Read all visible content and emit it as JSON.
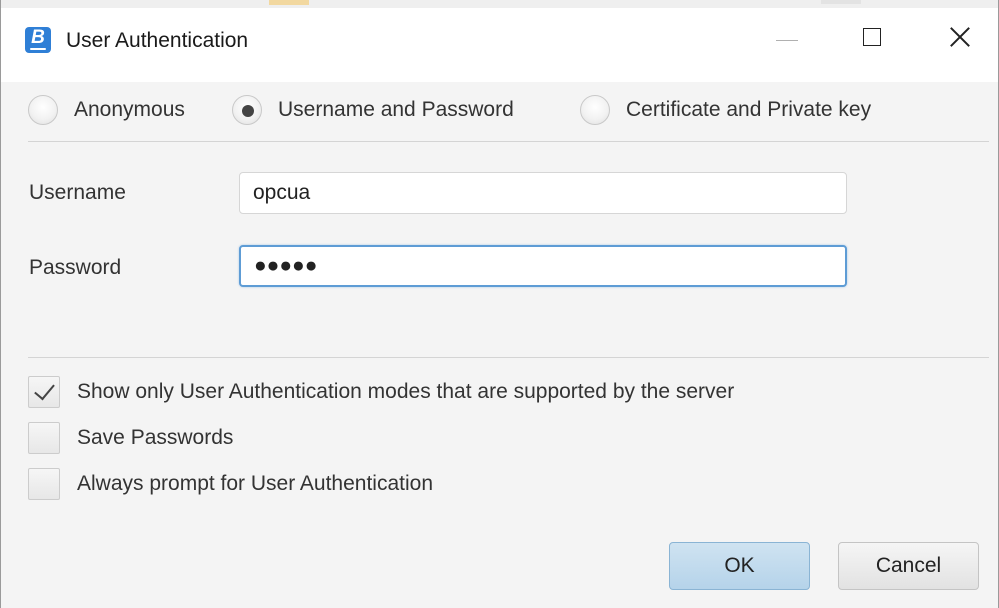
{
  "window": {
    "title": "User Authentication",
    "app_icon_letter": "B",
    "controls": [
      "minimize-icon",
      "maximize-icon",
      "close-icon"
    ]
  },
  "auth_modes": {
    "options": [
      {
        "label": "Anonymous",
        "selected": false
      },
      {
        "label": "Username and Password",
        "selected": true
      },
      {
        "label": "Certificate and Private key",
        "selected": false
      }
    ]
  },
  "form": {
    "username_label": "Username",
    "username_value": "opcua",
    "password_label": "Password",
    "password_value": "●●●●●"
  },
  "options": {
    "show_supported": {
      "label": "Show only User Authentication modes that are supported by the server",
      "checked": true
    },
    "save_passwords": {
      "label": "Save Passwords",
      "checked": false
    },
    "always_prompt": {
      "label": "Always prompt for User Authentication",
      "checked": false
    }
  },
  "buttons": {
    "ok": "OK",
    "cancel": "Cancel"
  },
  "colors": {
    "ok_button": "#b5d3ea",
    "focus_border": "#5e9cd5",
    "app_icon": "#2f7fd6"
  }
}
